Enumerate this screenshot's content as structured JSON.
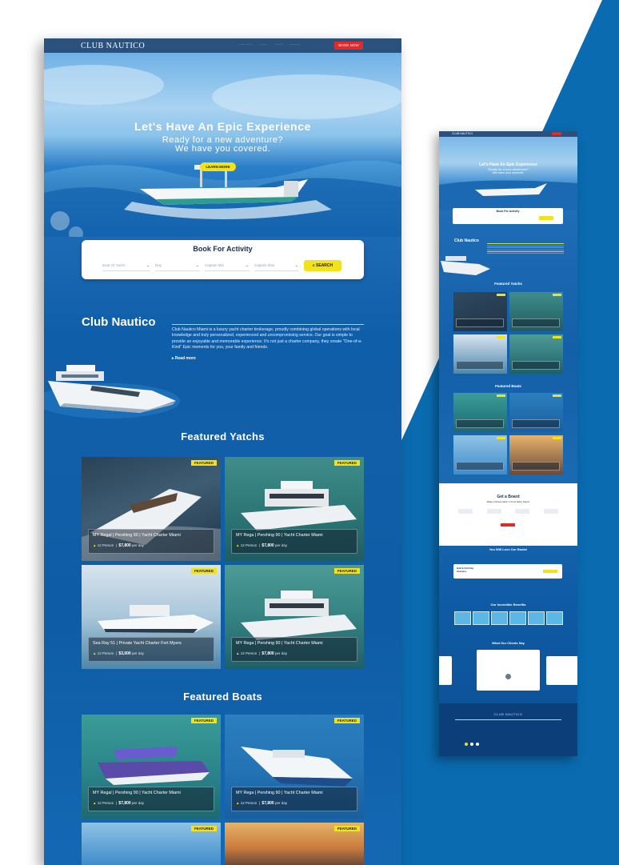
{
  "colors": {
    "accent": "#f2e21b",
    "brand_blue": "#0a6bb0",
    "cta_red": "#e02b2b",
    "navy": "#12305b"
  },
  "desktop": {
    "logo": "CLUB NAUTICO",
    "nav": {
      "book_btn": "BOOK NOW"
    },
    "hero": {
      "title": "Let's Have An Epic Experience",
      "subtitle_line1": "Ready for a new adventure?",
      "subtitle_line2": "We have you covered.",
      "cta": "LEARN MORE"
    },
    "booking": {
      "title": "Book For Activity",
      "fields": [
        {
          "placeholder": "Boat Or Yacht"
        },
        {
          "placeholder": "Day"
        },
        {
          "placeholder": "Captain Min"
        },
        {
          "placeholder": "Captain Max"
        }
      ],
      "search_label": "SEARCH"
    },
    "about": {
      "title": "Club Nautico",
      "text": "Club Nautico Miami is a luxury yacht charter brokerage, proudly combining global operations with local knowledge and truly personalized, experienced and uncompromising service. Our goal is simple to provide an enjoyable and memorable experience. It's not just a charter company, they create \"One-of-a-Kind\" Epic moments for you, your family and friends.",
      "read_more": "Read more"
    },
    "featured_yachts": {
      "title": "Featured Yatchs",
      "cards": [
        {
          "badge": "FEATURED",
          "title": "MY Regal | Pershing 90 | Yacht Charter Miami",
          "guests": "12 Person",
          "price": "$7,800",
          "unit": "per day"
        },
        {
          "badge": "FEATURED",
          "title": "MY Rega | Pershing 90 | Yacht Charter Miami",
          "guests": "12 Person",
          "price": "$7,800",
          "unit": "per day"
        },
        {
          "badge": "FEATURED",
          "title": "Sea Ray 51 | Private Yacht Charter Fort Myers",
          "guests": "12 Person",
          "price": "$3,000",
          "unit": "per day"
        },
        {
          "badge": "FEATURED",
          "title": "MY Rega | Pershing 90 | Yacht Charter Miami",
          "guests": "12 Person",
          "price": "$7,800",
          "unit": "per day"
        }
      ]
    },
    "featured_boats": {
      "title": "Featured Boats",
      "cards": [
        {
          "badge": "FEATURED",
          "title": "MY Regal | Pershing 90 | Yacht Charter Miami",
          "guests": "12 Person",
          "price": "$7,800",
          "unit": "per day"
        },
        {
          "badge": "FEATURED",
          "title": "MY Rega | Pershing 90 | Yacht Charter Miami",
          "guests": "12 Person",
          "price": "$7,800",
          "unit": "per day"
        },
        {
          "badge": "FEATURED"
        },
        {
          "badge": "FEATURED"
        }
      ]
    }
  },
  "mobile": {
    "hero_title": "Let's Have An Epic Experience",
    "booking_title": "Book For Activity",
    "about_title": "Club Nautico",
    "yachts_title": "Featured Yatchs",
    "boats_title": "Featured Boats",
    "get_a_board": "Get a Board",
    "get_a_board_sub": "Make a Reservation in Four Easy Steps!",
    "love_title": "You Will Love Our Boats!",
    "charters": "Half & Full Day Charters",
    "benefits_title": "Our Incredible Benefits",
    "clients_title": "What Our Clients Say",
    "footer_logo": "CLUB NAUTICO"
  }
}
